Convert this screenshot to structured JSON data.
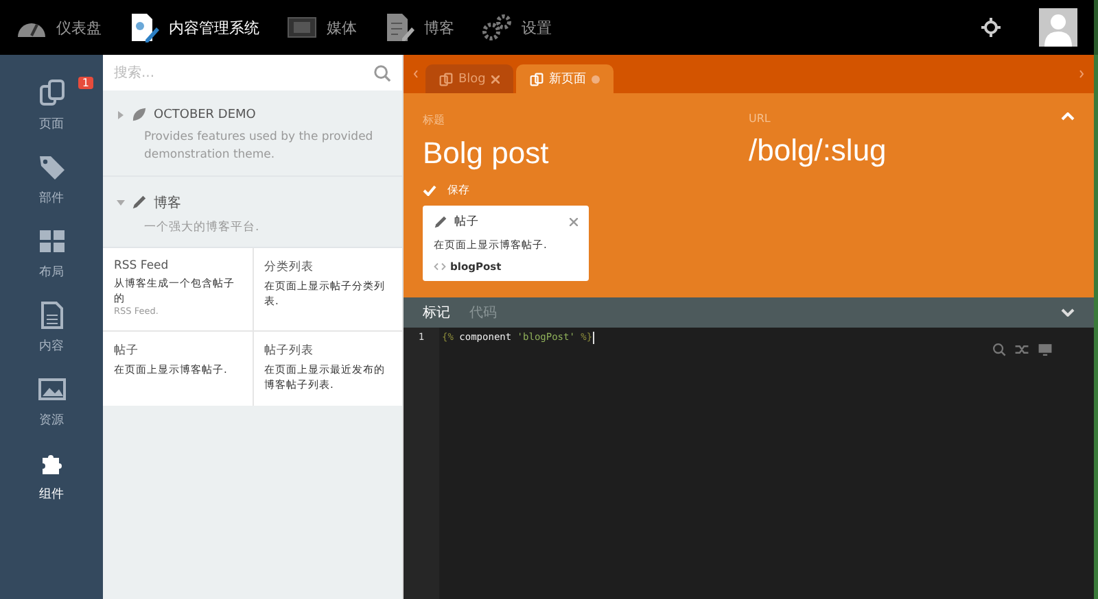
{
  "top_nav": [
    {
      "label": "仪表盘",
      "selected": false
    },
    {
      "label": "内容管理系统",
      "selected": true
    },
    {
      "label": "媒体",
      "selected": false
    },
    {
      "label": "博客",
      "selected": false
    },
    {
      "label": "设置",
      "selected": false
    }
  ],
  "sidebar": {
    "items": [
      {
        "label": "页面",
        "selected": false,
        "badge": "1"
      },
      {
        "label": "部件",
        "selected": false
      },
      {
        "label": "布局",
        "selected": false
      },
      {
        "label": "内容",
        "selected": false
      },
      {
        "label": "资源",
        "selected": false
      },
      {
        "label": "组件",
        "selected": true
      }
    ]
  },
  "component_panel": {
    "search": {
      "placeholder": "搜索..."
    },
    "groups": [
      {
        "name": "OCTOBER DEMO",
        "description": "Provides features used by the provided demonstration theme.",
        "expanded": false
      },
      {
        "name": "博客",
        "description": "一个强大的博客平台.",
        "expanded": true,
        "components": [
          {
            "name": "RSS Feed",
            "description": "从博客生成一个包含帖子的",
            "note": "RSS Feed."
          },
          {
            "name": "分类列表",
            "description": "在页面上显示帖子分类列表."
          },
          {
            "name": "帖子",
            "description": "在页面上显示博客帖子."
          },
          {
            "name": "帖子列表",
            "description": "在页面上显示最近发布的博客帖子列表."
          }
        ]
      }
    ]
  },
  "page_tabs": [
    {
      "label": "Blog",
      "selected": false
    },
    {
      "label": "新页面",
      "selected": true
    }
  ],
  "form": {
    "title_label": "标题",
    "title_value": "Bolg post",
    "url_label": "URL",
    "url_value": "/bolg/:slug",
    "save": "保存"
  },
  "component_card": {
    "name": "帖子",
    "description": "在页面上显示博客帖子.",
    "alias": "blogPost"
  },
  "editor": {
    "tabs": [
      {
        "label": "标记",
        "selected": true
      },
      {
        "label": "代码",
        "selected": false
      }
    ],
    "lines": [
      {
        "number": "1",
        "tokens": [
          {
            "kind": "delim",
            "text": "{%"
          },
          {
            "kind": "keyword",
            "text": " component "
          },
          {
            "kind": "string",
            "text": "'blogPost'"
          },
          {
            "kind": "delim",
            "text": " %}"
          }
        ]
      }
    ]
  }
}
